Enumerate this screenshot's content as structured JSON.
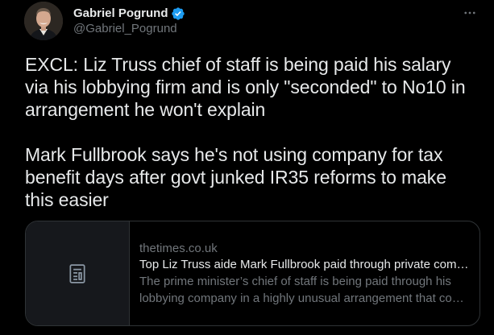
{
  "author": {
    "display_name": "Gabriel Pogrund",
    "handle": "@Gabriel_Pogrund",
    "verified": true,
    "avatar_icon": "profile-photo",
    "verified_icon": "verified-badge-icon"
  },
  "menu": {
    "icon": "more-options-icon"
  },
  "tweet": {
    "paragraph_1": "EXCL: Liz Truss chief of staff is being paid his salary via his lobbying firm and is only \"seconded\" to No10 in arrangement he won't explain",
    "paragraph_2": "Mark Fullbrook says he's not using company for tax benefit days after govt junked IR35 reforms to make this easier"
  },
  "link_card": {
    "icon": "article-icon",
    "domain": "thetimes.co.uk",
    "title": "Top Liz Truss aide Mark Fullbrook paid through private company",
    "description": "The prime minister’s chief of staff is being paid through his lobbying company in a highly unusual arrangement that could raise questions"
  },
  "colors": {
    "background": "#000000",
    "primary_text": "#e7e9ea",
    "secondary_text": "#71767b",
    "border": "#2f3336",
    "verified_blue": "#1d9bf0"
  }
}
